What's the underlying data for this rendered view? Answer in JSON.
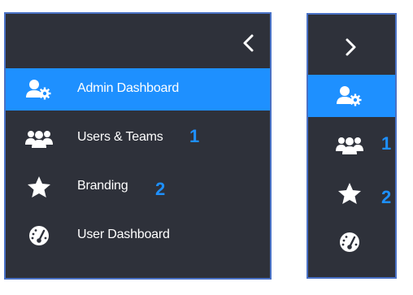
{
  "expanded_menu": {
    "toggle_icon": "chevron-left-icon",
    "items": [
      {
        "label": "Admin Dashboard",
        "icon": "admin-settings-icon",
        "active": true
      },
      {
        "label": "Users & Teams",
        "icon": "users-icon",
        "badge": "1"
      },
      {
        "label": "Branding",
        "icon": "star-icon",
        "badge": "2"
      },
      {
        "label": "User Dashboard",
        "icon": "dashboard-gauge-icon"
      }
    ]
  },
  "collapsed_menu": {
    "toggle_icon": "chevron-right-icon",
    "items": [
      {
        "icon": "admin-settings-icon",
        "active": true
      },
      {
        "icon": "users-icon",
        "badge": "1"
      },
      {
        "icon": "star-icon",
        "badge": "2"
      },
      {
        "icon": "dashboard-gauge-icon"
      }
    ]
  },
  "colors": {
    "panel_bg": "#2e313a",
    "panel_border": "#4a72c6",
    "active_bg": "#1e90ff",
    "badge_text": "#1e90ff",
    "icon_and_label": "#ffffff"
  }
}
